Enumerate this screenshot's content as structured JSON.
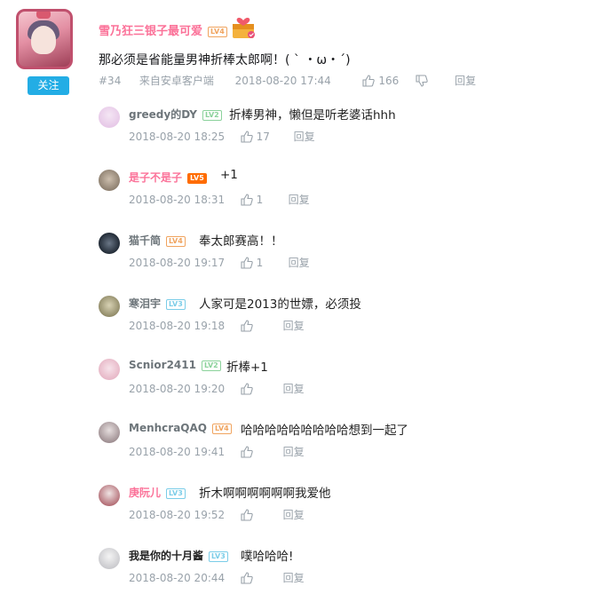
{
  "main": {
    "follow_label": "关注",
    "username": "雪乃狂三银子最可爱",
    "level": "LV4",
    "text": "那必须是省能量男神折棒太郎啊！( ` ・ω・´)",
    "floor": "#34",
    "source": "来自安卓客户端",
    "time": "2018-08-20 17:44",
    "likes": "166",
    "reply_label": "回复"
  },
  "replies": [
    {
      "name": "greedy的DY",
      "level": "LV2",
      "text": "折棒男神，懒但是听老婆话hhh",
      "time": "2018-08-20 18:25",
      "likes": "17",
      "reply_label": "回复"
    },
    {
      "name": "是子不是子",
      "level": "LV5",
      "text": "+1",
      "time": "2018-08-20 18:31",
      "likes": "1",
      "reply_label": "回复"
    },
    {
      "name": "猫千简",
      "level": "LV4",
      "text": "奉太郎赛高！！",
      "time": "2018-08-20 19:17",
      "likes": "1",
      "reply_label": "回复"
    },
    {
      "name": "寒泪宇",
      "level": "LV3",
      "text": "人家可是2013的世嫖，必须投",
      "time": "2018-08-20 19:18",
      "likes": "",
      "reply_label": "回复"
    },
    {
      "name": "Scnior2411",
      "level": "LV2",
      "text": "折棒+1",
      "time": "2018-08-20 19:20",
      "likes": "",
      "reply_label": "回复"
    },
    {
      "name": "MenhcraQAQ",
      "level": "LV4",
      "text": "哈哈哈哈哈哈哈哈哈想到一起了",
      "time": "2018-08-20 19:41",
      "likes": "",
      "reply_label": "回复"
    },
    {
      "name": "庚阮儿",
      "level": "LV3",
      "text": "折木啊啊啊啊啊啊我爱他",
      "time": "2018-08-20 19:52",
      "likes": "",
      "reply_label": "回复"
    },
    {
      "name": "我是你的十月酱",
      "level": "LV3",
      "text": "噗哈哈哈!",
      "time": "2018-08-20 20:44",
      "likes": "",
      "reply_label": "回复"
    }
  ],
  "icons": {
    "thumb_up": "thumb-up-icon",
    "thumb_down": "thumb-down-icon",
    "gift": "gift-icon"
  },
  "colors": {
    "vip_name": "#fb7299",
    "follow": "#23ade5",
    "meta": "#99a2aa"
  }
}
